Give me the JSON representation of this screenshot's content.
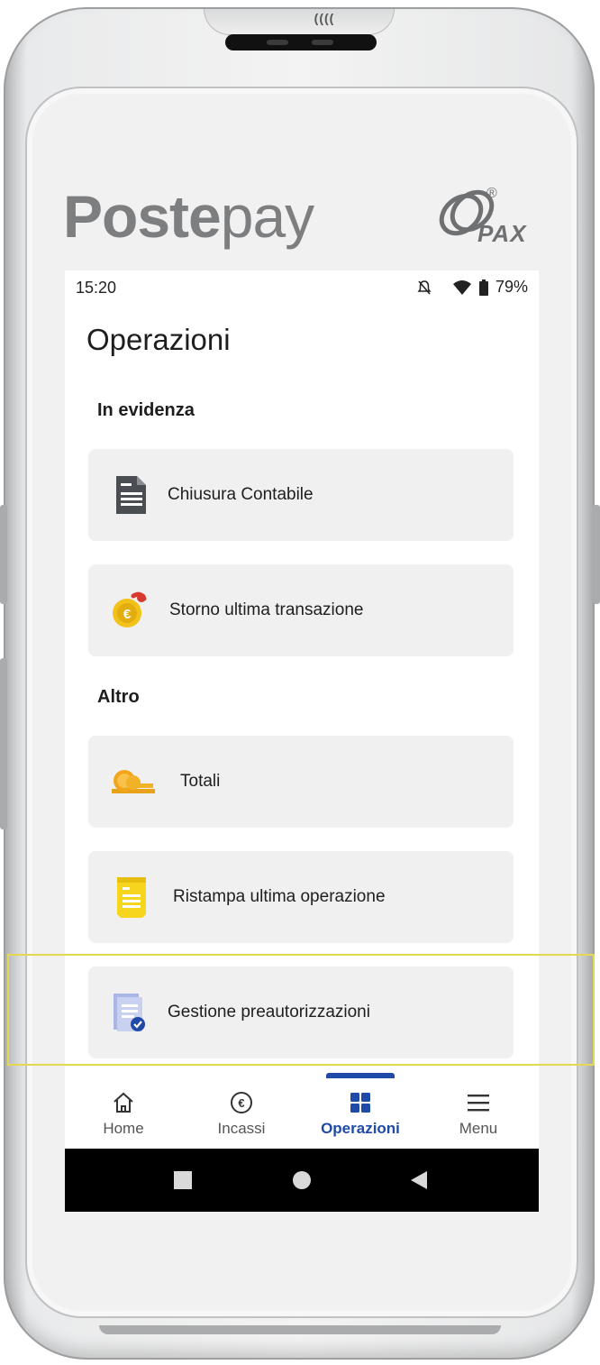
{
  "device": {
    "brand_left": "Poste",
    "brand_right": "pay",
    "manufacturer": "PAX",
    "registered_mark": "®",
    "nfc_mark": "((((",
    "colors": {
      "body": "#f1f1f1",
      "brand_text": "#7c7e80"
    }
  },
  "status_bar": {
    "time": "15:20",
    "battery": "79%",
    "icons": [
      "bell-off-icon",
      "wifi-icon",
      "battery-icon"
    ]
  },
  "page": {
    "title": "Operazioni"
  },
  "sections": [
    {
      "title": "In evidenza",
      "items": [
        {
          "label": "Chiusura Contabile",
          "icon": "document-icon"
        },
        {
          "label": "Storno ultima transazione",
          "icon": "euro-coin-refund-icon"
        }
      ]
    },
    {
      "title": "Altro",
      "items": [
        {
          "label": "Totali",
          "icon": "coins-stack-icon"
        },
        {
          "label": "Ristampa ultima operazione",
          "icon": "receipt-icon"
        },
        {
          "label": "Gestione preautorizzazioni",
          "icon": "preauth-document-icon"
        }
      ]
    }
  ],
  "bottom_nav": {
    "items": [
      {
        "label": "Home",
        "icon": "home-icon"
      },
      {
        "label": "Incassi",
        "icon": "euro-circle-icon"
      },
      {
        "label": "Operazioni",
        "icon": "grid-icon",
        "active": true
      },
      {
        "label": "Menu",
        "icon": "hamburger-icon"
      }
    ],
    "active_color": "#1f4aa8"
  },
  "system_nav": [
    "recent-apps-icon",
    "home-circle-icon",
    "back-icon"
  ],
  "highlight": {
    "target": "Gestione preautorizzazioni",
    "color": "#e2d950"
  }
}
